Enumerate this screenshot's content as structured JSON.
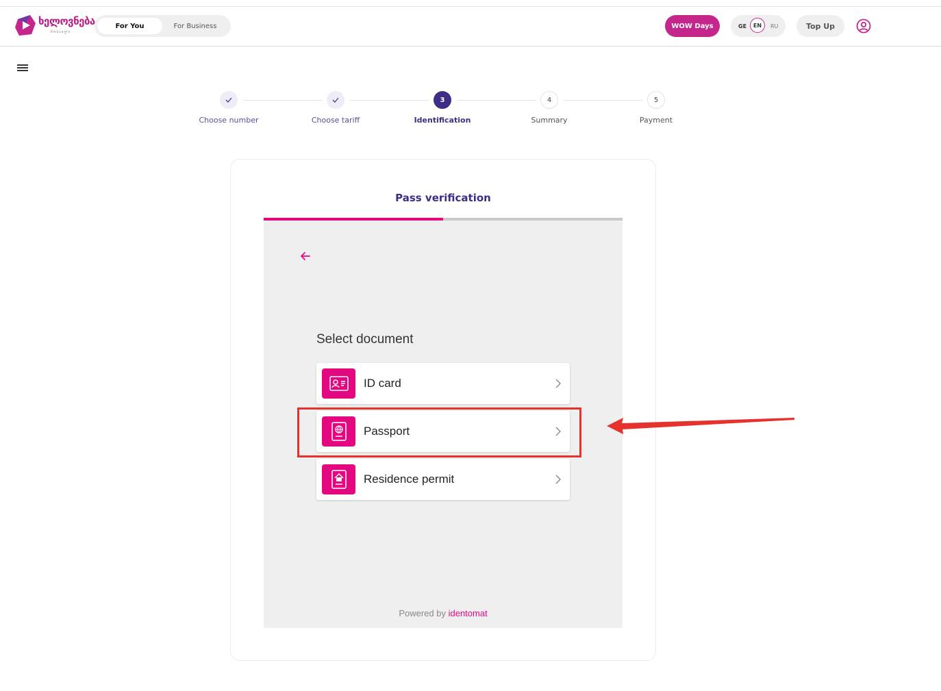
{
  "header": {
    "logo_text": "ხელოვნება",
    "logo_sub": "მობაილი",
    "segments": [
      "For You",
      "For Business"
    ],
    "active_segment": "For You",
    "wow_label": "WOW Days",
    "languages": [
      "GE",
      "EN",
      "RU"
    ],
    "active_language": "EN",
    "topup_label": "Top Up",
    "user_icon": "user-circle-icon",
    "menu_icon": "hamburger-menu-icon"
  },
  "stepper": {
    "steps": [
      {
        "number": "1",
        "label": "Choose number",
        "state": "done"
      },
      {
        "number": "2",
        "label": "Choose tariff",
        "state": "done"
      },
      {
        "number": "3",
        "label": "Identification",
        "state": "active"
      },
      {
        "number": "4",
        "label": "Summary",
        "state": "todo"
      },
      {
        "number": "5",
        "label": "Payment",
        "state": "todo"
      }
    ]
  },
  "verification": {
    "title": "Pass verification",
    "progress_fraction": 0.5,
    "back_icon": "arrow-left-icon",
    "select_title": "Select document",
    "documents": [
      {
        "label": "ID card",
        "icon": "id-card-icon"
      },
      {
        "label": "Passport",
        "icon": "passport-icon"
      },
      {
        "label": "Residence permit",
        "icon": "residence-permit-icon"
      }
    ],
    "highlighted_document": "Passport",
    "powered_prefix": "Powered by",
    "powered_brand": "identomat"
  },
  "colors": {
    "brand_magenta": "#e3087f",
    "brand_purple": "#3f2d86",
    "wow_button": "#c4268c",
    "annotation_red": "#e5322d"
  }
}
